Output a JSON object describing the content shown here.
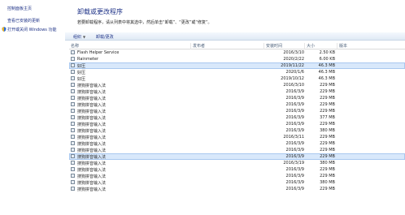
{
  "sidebar": {
    "home_link": "控制面板主页",
    "updates_link": "查看已安装的更新",
    "features_link": "打开或关闭 Windows 功能"
  },
  "main": {
    "title": "卸载或更改程序",
    "description": "若要卸载程序，请从列表中将其选中，然后单击“卸载”、“更改”或“修复”。"
  },
  "toolbar": {
    "organize_label": "组织",
    "uninstall_change_label": "卸载/更改"
  },
  "columns": {
    "name": "名称",
    "publisher": "发布者",
    "installed_on": "安装时间",
    "size": "大小",
    "version": "版本"
  },
  "rows": [
    {
      "name": "Flash Helper Service",
      "publisher": "",
      "date": "2016/3/10",
      "size": "2.50 KB",
      "selected": false
    },
    {
      "name": "Rainmeter",
      "publisher": "",
      "date": "2020/2/22",
      "size": "6.00 KB",
      "selected": false
    },
    {
      "name": "好压",
      "publisher": "",
      "date": "2019/11/22",
      "size": "46.3 MB",
      "selected": true
    },
    {
      "name": "好压",
      "publisher": "",
      "date": "2020/1/6",
      "size": "46.3 MB",
      "selected": false
    },
    {
      "name": "好压",
      "publisher": "",
      "date": "2019/10/12",
      "size": "46.3 MB",
      "selected": false
    },
    {
      "name": "搜狗拼音输入法",
      "publisher": "",
      "date": "2016/3/10",
      "size": "229 MB",
      "selected": false
    },
    {
      "name": "搜狗拼音输入法",
      "publisher": "",
      "date": "2016/3/9",
      "size": "229 MB",
      "selected": false
    },
    {
      "name": "搜狗拼音输入法",
      "publisher": "",
      "date": "2016/3/9",
      "size": "229 MB",
      "selected": false
    },
    {
      "name": "搜狗拼音输入法",
      "publisher": "",
      "date": "2016/3/9",
      "size": "229 MB",
      "selected": false
    },
    {
      "name": "搜狗拼音输入法",
      "publisher": "",
      "date": "2016/3/9",
      "size": "229 MB",
      "selected": false
    },
    {
      "name": "搜狗拼音输入法",
      "publisher": "",
      "date": "2016/3/9",
      "size": "377 MB",
      "selected": false
    },
    {
      "name": "搜狗拼音输入法",
      "publisher": "",
      "date": "2016/3/9",
      "size": "229 MB",
      "selected": false
    },
    {
      "name": "搜狗拼音输入法",
      "publisher": "",
      "date": "2016/3/9",
      "size": "380 MB",
      "selected": false
    },
    {
      "name": "搜狗拼音输入法",
      "publisher": "",
      "date": "2016/3/11",
      "size": "229 MB",
      "selected": false
    },
    {
      "name": "搜狗拼音输入法",
      "publisher": "",
      "date": "2016/3/9",
      "size": "229 MB",
      "selected": false
    },
    {
      "name": "搜狗拼音输入法",
      "publisher": "",
      "date": "2016/3/9",
      "size": "229 MB",
      "selected": false
    },
    {
      "name": "搜狗拼音输入法",
      "publisher": "",
      "date": "2016/3/9",
      "size": "229 MB",
      "selected": true
    },
    {
      "name": "搜狗拼音输入法",
      "publisher": "",
      "date": "2016/3/19",
      "size": "380 MB",
      "selected": false
    },
    {
      "name": "搜狗拼音输入法",
      "publisher": "",
      "date": "2016/3/9",
      "size": "229 MB",
      "selected": false
    },
    {
      "name": "搜狗拼音输入法",
      "publisher": "",
      "date": "2016/3/9",
      "size": "229 MB",
      "selected": false
    },
    {
      "name": "搜狗拼音输入法",
      "publisher": "",
      "date": "2016/3/9",
      "size": "380 MB",
      "selected": false
    },
    {
      "name": "搜狗拼音输入法",
      "publisher": "",
      "date": "2016/3/9",
      "size": "229 MB",
      "selected": false
    }
  ],
  "colors": {
    "link": "#1e3287",
    "selected_row": "#d8e8fb",
    "toolbar": "#dfe9f5"
  }
}
